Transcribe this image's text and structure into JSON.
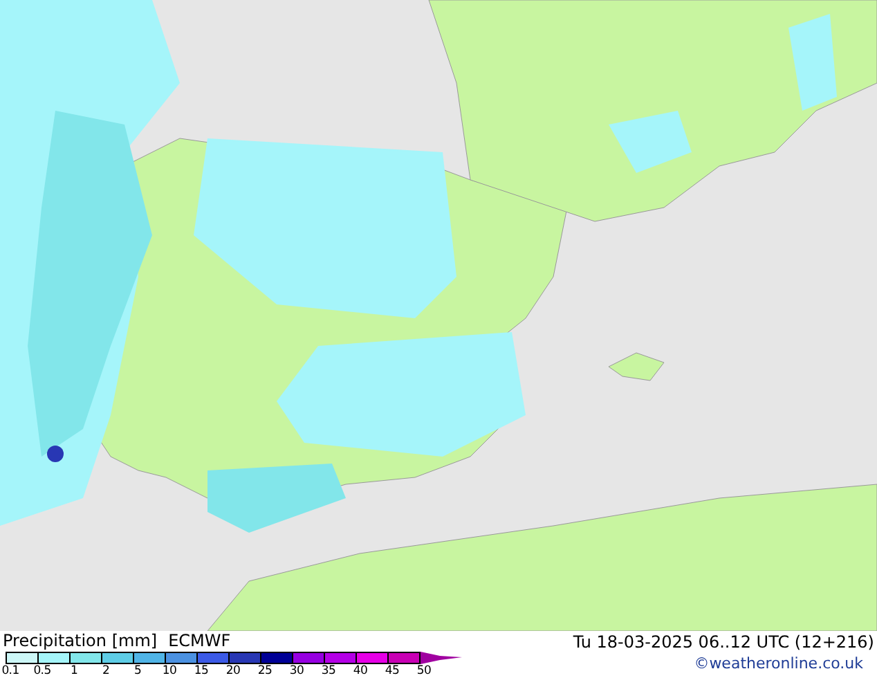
{
  "legend": {
    "title": "Precipitation [mm]",
    "model": "ECMWF",
    "bands": [
      {
        "color": "#cdf7f7"
      },
      {
        "color": "#a5f5fa"
      },
      {
        "color": "#82e6ea"
      },
      {
        "color": "#5ecde6"
      },
      {
        "color": "#50b4e6"
      },
      {
        "color": "#4b91e1"
      },
      {
        "color": "#3c5ae6"
      },
      {
        "color": "#2837b4"
      },
      {
        "color": "#000096"
      },
      {
        "color": "#9600e1"
      },
      {
        "color": "#b400e6"
      },
      {
        "color": "#e600e6"
      },
      {
        "color": "#c800b4"
      }
    ],
    "labels": [
      "0.1",
      "0.5",
      "1",
      "2",
      "5",
      "10",
      "15",
      "20",
      "25",
      "30",
      "35",
      "40",
      "45",
      "50"
    ]
  },
  "valid_time": "Tu 18-03-2025 06..12 UTC (12+216)",
  "credit": "©weatheronline.co.uk"
}
